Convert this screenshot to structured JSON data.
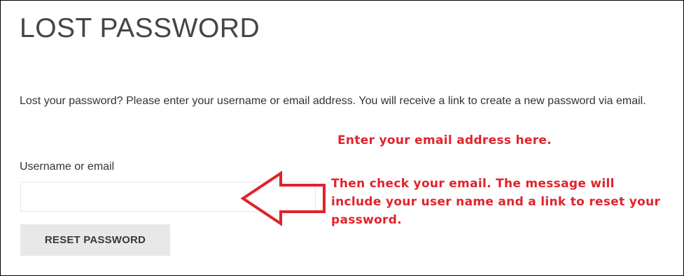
{
  "page": {
    "title": "LOST PASSWORD",
    "intro": "Lost your password? Please enter your username or email address. You will receive a link to create a new password via email."
  },
  "form": {
    "field_label": "Username or email",
    "field_value": "",
    "submit_label": "RESET PASSWORD"
  },
  "annotation": {
    "line1": "Enter your email address here.",
    "line2": "Then check your email. The message will include your user name and a link to reset your password.",
    "color": "#e0232b",
    "arrow_icon": "left-arrow-outline-icon"
  }
}
